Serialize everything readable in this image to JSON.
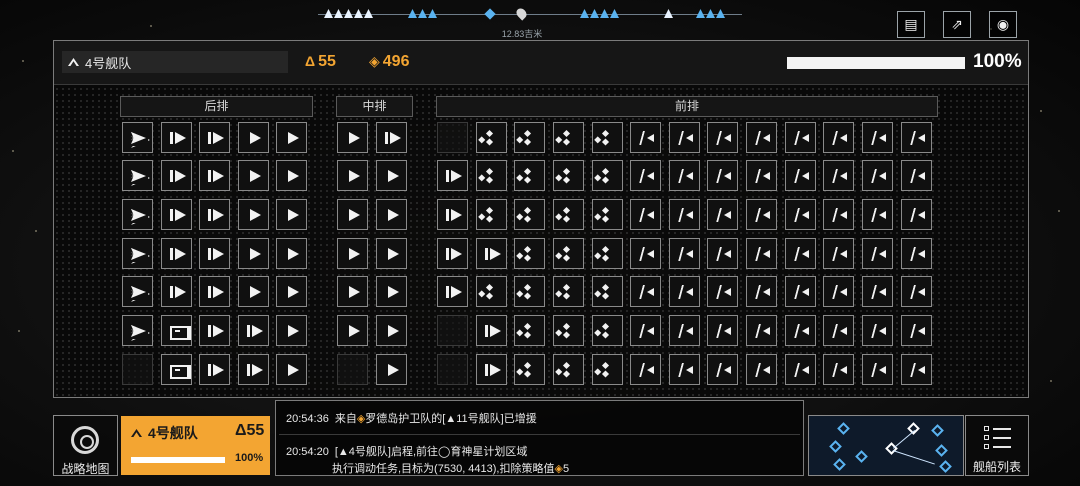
{
  "top_nav": {
    "distance": "12.83吉米",
    "icons": [
      "fleet-marker-white",
      "fleet-marker-blue",
      "diamond-node",
      "location-pin",
      "fleet-marker-blue",
      "fleet-marker-blue"
    ]
  },
  "toolbar": {
    "icons": [
      "stream-icon",
      "share-icon",
      "eye-icon"
    ]
  },
  "fleet_panel": {
    "fleet_name": "4号舰队",
    "stat_a_symbol": "Δ",
    "stat_a_value": "55",
    "stat_b_symbol": "◈",
    "stat_b_value": "496",
    "integrity_percent": "100%",
    "integrity_fraction": 1.0,
    "accent": "#f3a532"
  },
  "formation": {
    "rear_label": "后排",
    "middle_label": "中排",
    "front_label": "前排"
  },
  "bottom": {
    "map_label": "战略地图",
    "card_name": "4号舰队",
    "card_stat": "Δ55",
    "card_percent": "100%",
    "ship_list_label": "舰船列表"
  },
  "log": {
    "entry1_time": "20:54:36",
    "entry1_text_a": "来自",
    "entry1_text_b": "罗德岛护卫队的[",
    "entry1_text_c": "11号舰队]已增援",
    "entry2_time": "20:54:20",
    "entry2_text_a": "[",
    "entry2_text_b": "4号舰队]启程,前往",
    "entry2_text_c": "育神星计划区域",
    "entry3_text_a": "执行调动任务,目标为(7530, 4413),扣除策略值",
    "entry3_text_b": "5"
  }
}
